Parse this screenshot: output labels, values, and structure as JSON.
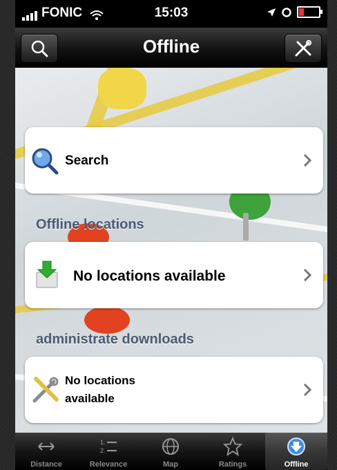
{
  "status_bar": {
    "carrier": "FONIC",
    "time": "15:03"
  },
  "nav": {
    "title": "Offline",
    "left_icon": "search-icon",
    "right_icon": "tools-icon"
  },
  "search_cell": {
    "label": "Search",
    "icon": "magnifier-icon"
  },
  "offline_locations": {
    "header": "Offline locations",
    "empty_label": "No locations available"
  },
  "administrate_downloads": {
    "header": "administrate downloads",
    "label_line1": "No locations",
    "label_line2": "available"
  },
  "tab_bar": {
    "tabs": [
      {
        "label": "Distance",
        "icon": "distance-arrows-icon"
      },
      {
        "label": "Relevance",
        "icon": "numbered-list-icon"
      },
      {
        "label": "Map",
        "icon": "globe-icon"
      },
      {
        "label": "Ratings",
        "icon": "star-icon"
      },
      {
        "label": "Offline",
        "icon": "download-icon"
      }
    ],
    "active": "Offline"
  }
}
